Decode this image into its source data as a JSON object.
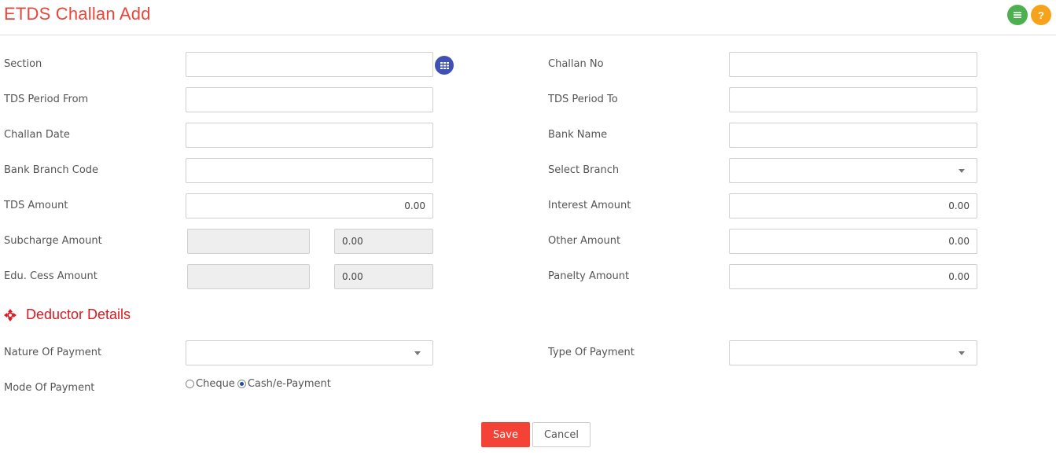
{
  "page": {
    "title": "ETDS Challan Add"
  },
  "header_buttons": {
    "list_icon": "list-icon",
    "help_icon": "help-icon",
    "help_glyph": "?"
  },
  "colors": {
    "title": "#e8463b",
    "save": "#f44336",
    "section": "#d9181f",
    "green": "#4caf50",
    "orange": "#f7a21b",
    "lookup": "#3f51b5"
  },
  "form": {
    "section": {
      "label": "Section",
      "value": ""
    },
    "challan_no": {
      "label": "Challan No",
      "value": ""
    },
    "tds_period_from": {
      "label": "TDS Period From",
      "value": ""
    },
    "tds_period_to": {
      "label": "TDS Period To",
      "value": ""
    },
    "challan_date": {
      "label": "Challan Date",
      "value": ""
    },
    "bank_name": {
      "label": "Bank Name",
      "value": ""
    },
    "bank_branch_code": {
      "label": "Bank Branch Code",
      "value": ""
    },
    "select_branch": {
      "label": "Select Branch",
      "value": ""
    },
    "tds_amount": {
      "label": "TDS Amount",
      "value": "0.00"
    },
    "interest_amount": {
      "label": "Interest Amount",
      "value": "0.00"
    },
    "subcharge_amount": {
      "label": "Subcharge Amount",
      "rate": "",
      "value": "0.00"
    },
    "other_amount": {
      "label": "Other Amount",
      "value": "0.00"
    },
    "edu_cess_amount": {
      "label": "Edu. Cess Amount",
      "rate": "",
      "value": "0.00"
    },
    "panelty_amount": {
      "label": "Panelty Amount",
      "value": "0.00"
    }
  },
  "deductor": {
    "heading": "Deductor Details",
    "nature_of_payment": {
      "label": "Nature Of Payment",
      "value": ""
    },
    "type_of_payment": {
      "label": "Type Of Payment",
      "value": ""
    },
    "mode_of_payment": {
      "label": "Mode Of Payment",
      "options": [
        {
          "label": "Cheque",
          "checked": false
        },
        {
          "label": "Cash/e-Payment",
          "checked": true
        }
      ]
    }
  },
  "actions": {
    "save": "Save",
    "cancel": "Cancel"
  }
}
